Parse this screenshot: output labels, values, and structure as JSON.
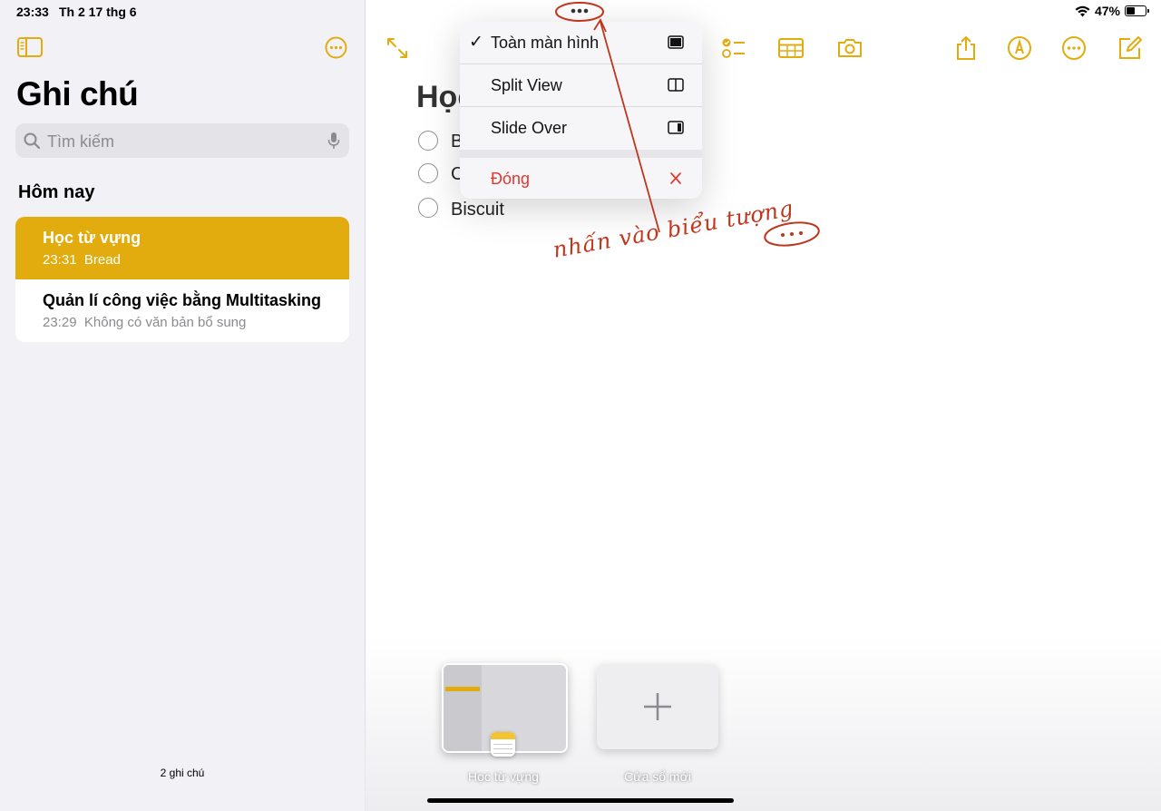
{
  "status": {
    "time": "23:33",
    "date": "Th 2 17 thg 6",
    "battery": "47%",
    "battery_level": 0.47
  },
  "sidebar": {
    "title": "Ghi chú",
    "search_placeholder": "Tìm kiếm",
    "section": "Hôm nay",
    "notes": [
      {
        "title": "Học từ vựng",
        "time": "23:31",
        "preview": "Bread",
        "selected": true
      },
      {
        "title": "Quản lí công việc bằng Multitasking",
        "time": "23:29",
        "preview": "Không có văn bản bổ sung",
        "selected": false
      }
    ],
    "count": "2 ghi chú"
  },
  "note": {
    "title": "Học",
    "items": [
      "B",
      "C",
      "Biscuit"
    ]
  },
  "menu": {
    "items": [
      {
        "label": "Toàn màn hình",
        "checked": true,
        "icon": "fullscreen-icon"
      },
      {
        "label": "Split View",
        "checked": false,
        "icon": "split-view-icon"
      },
      {
        "label": "Slide Over",
        "checked": false,
        "icon": "slide-over-icon"
      },
      {
        "label": "Đóng",
        "icon": "close-icon",
        "destructive": true
      }
    ],
    "check": "✓"
  },
  "annotation": {
    "text": "nhấn vào biểu tượng"
  },
  "switcher": {
    "current_label": "Học từ vựng",
    "new_label": "Cửa sổ mới"
  },
  "colors": {
    "accent": "#e3ac0e",
    "destructive": "#e0382f",
    "annotation": "#c0361c"
  }
}
